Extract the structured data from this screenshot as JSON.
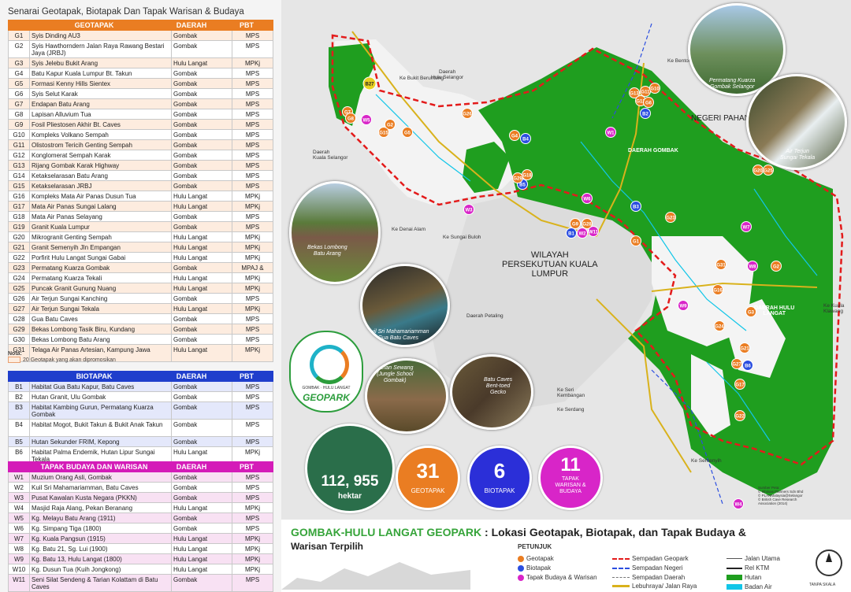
{
  "panel_title": "Senarai Geotapak, Biotapak Dan Tapak Warisan & Budaya",
  "geo_header": [
    "GEOTAPAK",
    "DAERAH",
    "PBT"
  ],
  "geo_rows": [
    [
      "G1",
      "Syis Dinding AU3",
      "Gombak",
      "MPS"
    ],
    [
      "G2",
      "Syis Hawthorndern Jalan Raya Rawang Bestari Jaya (JRBJ)",
      "Gombak",
      "MPS"
    ],
    [
      "G3",
      "Syis Jelebu Bukit Arang",
      "Hulu Langat",
      "MPKj"
    ],
    [
      "G4",
      "Batu Kapur Kuala Lumpur Bt. Takun",
      "Gombak",
      "MPS"
    ],
    [
      "G5",
      "Formasi Kenny Hills Sientex",
      "Gombak",
      "MPS"
    ],
    [
      "G6",
      "Syis Selut Karak",
      "Gombak",
      "MPS"
    ],
    [
      "G7",
      "Endapan Batu Arang",
      "Gombak",
      "MPS"
    ],
    [
      "G8",
      "Lapisan Alluvium Tua",
      "Gombak",
      "MPS"
    ],
    [
      "G9",
      "Fosil Pliestosen Akhir Bt. Caves",
      "Gombak",
      "MPS"
    ],
    [
      "G10",
      "Kompleks Volkano Sempah",
      "Gombak",
      "MPS"
    ],
    [
      "G11",
      "Olistostrom Tericih Genting Sempah",
      "Gombak",
      "MPS"
    ],
    [
      "G12",
      "Konglomerat Sempah Karak",
      "Gombak",
      "MPS"
    ],
    [
      "G13",
      "Rijang Gombak Karak Highway",
      "Gombak",
      "MPS"
    ],
    [
      "G14",
      "Ketakselarasan Batu Arang",
      "Gombak",
      "MPS"
    ],
    [
      "G15",
      "Ketakselarasan JRBJ",
      "Gombak",
      "MPS"
    ],
    [
      "G16",
      "Kompleks Mata Air Panas Dusun Tua",
      "Hulu Langat",
      "MPKj"
    ],
    [
      "G17",
      "Mata Air Panas Sungai Lalang",
      "Hulu Langat",
      "MPKj"
    ],
    [
      "G18",
      "Mata Air Panas Selayang",
      "Gombak",
      "MPS"
    ],
    [
      "G19",
      "Granit Kuala Lumpur",
      "Gombak",
      "MPS"
    ],
    [
      "G20",
      "Mikrogranit Genting Sempah",
      "Hulu Langat",
      "MPKj"
    ],
    [
      "G21",
      "Granit Semenyih Jln Empangan",
      "Hulu Langat",
      "MPKj"
    ],
    [
      "G22",
      "Porfirit Hulu Langat Sungai Gabai",
      "Hulu Langat",
      "MPKj"
    ],
    [
      "G23",
      "Permatang Kuarza Gombak",
      "Gombak",
      "MPAJ & MPS"
    ],
    [
      "G24",
      "Permatang Kuarza Tekali",
      "Hulu Langat",
      "MPKj"
    ],
    [
      "G25",
      "Puncak Granit Gunung Nuang",
      "Hulu Langat",
      "MPKj"
    ],
    [
      "G26",
      "Air Terjun Sungai Kanching",
      "Gombak",
      "MPS"
    ],
    [
      "G27",
      "Air Terjun Sungai Tekala",
      "Hulu Langat",
      "MPKj"
    ],
    [
      "G28",
      "Gua Batu Caves",
      "Gombak",
      "MPS"
    ],
    [
      "G29",
      "Bekas Lombong Tasik Biru, Kundang",
      "Gombak",
      "MPS"
    ],
    [
      "G30",
      "Bekas Lombong Batu Arang",
      "Gombak",
      "MPS"
    ],
    [
      "G31",
      "Telaga Air Panas Artesian, Kampung Jawa",
      "Hulu Langat",
      "MPKj"
    ]
  ],
  "note_title": "Nota:",
  "note_text": "20 Geotapak yang akan dipromosikan",
  "bio_header": [
    "BIOTAPAK",
    "DAERAH",
    "PBT"
  ],
  "bio_rows": [
    [
      "B1",
      "Habitat Gua Batu Kapur, Batu Caves",
      "Gombak",
      "MPS"
    ],
    [
      "B2",
      "Hutan Granit, Ulu Gombak",
      "Gombak",
      "MPS"
    ],
    [
      "B3",
      "Habitat Kambing Gurun, Permatang Kuarza Gombak",
      "Gombak",
      "MPS"
    ],
    [
      "B4",
      "Habitat Mogot, Bukit Takun & Bukit Anak Takun",
      "Gombak",
      "MPS"
    ],
    [
      "B5",
      "Hutan Sekunder FRIM, Kepong",
      "Gombak",
      "MPS"
    ],
    [
      "B6",
      "Habitat Palma Endemik, Hutan Lipur Sungai Tekala",
      "Hulu Langat",
      "MPKj"
    ]
  ],
  "wb_header": [
    "TAPAK BUDAYA DAN WARISAN",
    "DAERAH",
    "PBT"
  ],
  "wb_rows": [
    [
      "W1",
      "Muzium Orang Asli, Gombak",
      "Gombak",
      "MPS"
    ],
    [
      "W2",
      "Kuil Sri Mahamariamman, Batu Caves",
      "Gombak",
      "MPS"
    ],
    [
      "W3",
      "Pusat Kawalan Kusta Negara (PKKN)",
      "Gombak",
      "MPS"
    ],
    [
      "W4",
      "Masjid Raja Alang, Pekan Beranang",
      "Hulu Langat",
      "MPKj"
    ],
    [
      "W5",
      "Kg. Melayu Batu Arang (1911)",
      "Gombak",
      "MPS"
    ],
    [
      "W6",
      "Kg. Simpang Tiga (1800)",
      "Gombak",
      "MPS"
    ],
    [
      "W7",
      "Kg. Kuala Pangsun (1915)",
      "Hulu Langat",
      "MPKj"
    ],
    [
      "W8",
      "Kg. Batu 21, Sg. Lui (1900)",
      "Hulu Langat",
      "MPKj"
    ],
    [
      "W9",
      "Kg. Batu 13, Hulu Langat (1800)",
      "Hulu Langat",
      "MPKj"
    ],
    [
      "W10",
      "Kg. Dusun Tua (Kuih Jongkong)",
      "Hulu Langat",
      "MPKj"
    ],
    [
      "W11",
      "Seni Silat Sendeng & Tarian Kolattam di Batu Caves",
      "Gombak",
      "MPS"
    ]
  ],
  "map_labels": {
    "hulu_selangor": "Daerah\nHulu Selangor",
    "kuala_selangor": "Daerah\nKuala Selangor",
    "negeri_pahang": "NEGERI PAHANG",
    "daerah_gombak": "DAERAH GOMBAK",
    "wp_kl": "WILAYAH\nPERSEKUTUAN KUALA\nLUMPUR",
    "daerah_petaling": "Daerah Petaling",
    "daerah_hulu_langat": "DAERAH HULU\nLANGAT",
    "to_bukit_beruntung": "Ke Bukit Beruntung",
    "to_bentong": "Ke Bentong",
    "to_sungai_buloh": "Ke Sungai Buloh",
    "to_denai_alam": "Ke Denai Alam",
    "to_seri_kembangan": "Ke Seri\nKembangan",
    "to_serdang": "Ke Serdang",
    "to_semenyih": "Ke Semenyih",
    "to_kuala_klawang": "Ke Kuala\nKlawang"
  },
  "photo_captions": {
    "permatang": "Permatang Kuarza\nGombak Selangor",
    "air_terjun": "Air Terjun\nSungai Tekala",
    "lombong": "Bekas Lombong\nBatu Arang",
    "kuil": "Kuil Sri Mahamariamman\nGua Batu Caves",
    "tarian": "Tarian Sewang\n(Jungle School\nGombak)",
    "gecko": "Batu Caves\nBent-toed\nGecko"
  },
  "logo": {
    "top_text": "GOMBAK · HULU LANGAT",
    "name": "GEOPARK"
  },
  "stats": {
    "area_value": "112, 955",
    "area_unit": "hektar",
    "geo_count": "31",
    "geo_label": "GEOTAPAK",
    "bio_count": "6",
    "bio_label": "BIOTAPAK",
    "wb_count": "11",
    "wb_label": "TAPAK\nWARISAN &\nBUDAYA"
  },
  "footer": {
    "title_green": "GOMBAK-HULU LANGAT GEOPARK",
    "title_rest": " : Lokasi Geotapak, Biotapak, dan Tapak Budaya &",
    "subtitle": "Warisan Terpilih",
    "legend_title": "PETUNJUK",
    "legend": {
      "geo": "Geotapak",
      "bio": "Biotapak",
      "wb": "Tapak Budaya & Warisan",
      "sempadan_geopark": "Sempadan Geopark",
      "sempadan_negeri": "Sempadan Negeri",
      "sempadan_daerah": "Sempadan Daerah",
      "lebuhraya": "Lebuhraya/ Jalan Raya",
      "jalan_utama": "Jalan Utama",
      "rel_ktm": "Rel KTM",
      "hutan": "Hutan",
      "badan_air": "Badan Air"
    },
    "scale": "TANPA SKALA",
    "source": "Sumber Peta:\n© Ikhtisas Planners Sdn Bhd\n© PLANMalaysia@Selangor\n© British Cave Research\nAssociation (2014)"
  },
  "colors": {
    "forest": "#1f9e1f",
    "geo": "#ea7d22",
    "bio": "#2b4ee0",
    "wb": "#d825c8",
    "boundary": "#e31b1b",
    "water": "#12c6e8"
  },
  "markers": [
    {
      "id": "B27",
      "type": "road"
    },
    {
      "id": "G7",
      "type": "geo"
    },
    {
      "id": "G8",
      "type": "geo"
    },
    {
      "id": "W5",
      "type": "wb"
    },
    {
      "id": "G2",
      "type": "geo"
    },
    {
      "id": "G15",
      "type": "geo"
    },
    {
      "id": "G5",
      "type": "geo"
    },
    {
      "id": "G26",
      "type": "geo"
    },
    {
      "id": "G4",
      "type": "geo"
    },
    {
      "id": "B4",
      "type": "bio"
    },
    {
      "id": "G13",
      "type": "geo"
    },
    {
      "id": "G12",
      "type": "geo"
    },
    {
      "id": "G11",
      "type": "geo"
    },
    {
      "id": "G6",
      "type": "geo"
    },
    {
      "id": "G10",
      "type": "geo"
    },
    {
      "id": "B2",
      "type": "bio"
    },
    {
      "id": "W1",
      "type": "wb"
    },
    {
      "id": "G18",
      "type": "geo"
    },
    {
      "id": "B5",
      "type": "bio"
    },
    {
      "id": "G29",
      "type": "geo"
    },
    {
      "id": "W3",
      "type": "wb"
    },
    {
      "id": "W6",
      "type": "wb"
    },
    {
      "id": "B3",
      "type": "bio"
    },
    {
      "id": "G9",
      "type": "geo"
    },
    {
      "id": "G28",
      "type": "geo"
    },
    {
      "id": "B1",
      "type": "bio"
    },
    {
      "id": "W2",
      "type": "wb"
    },
    {
      "id": "W11",
      "type": "wb"
    },
    {
      "id": "G23",
      "type": "geo"
    },
    {
      "id": "G1",
      "type": "geo"
    },
    {
      "id": "G20",
      "type": "geo"
    },
    {
      "id": "G25",
      "type": "geo"
    },
    {
      "id": "W7",
      "type": "wb"
    },
    {
      "id": "G31",
      "type": "geo"
    },
    {
      "id": "W8",
      "type": "wb"
    },
    {
      "id": "G2",
      "type": "geo"
    },
    {
      "id": "G16",
      "type": "geo"
    },
    {
      "id": "W9",
      "type": "wb"
    },
    {
      "id": "G3",
      "type": "geo"
    },
    {
      "id": "G24",
      "type": "geo"
    },
    {
      "id": "G21",
      "type": "geo"
    },
    {
      "id": "G27",
      "type": "geo"
    },
    {
      "id": "B6",
      "type": "bio"
    },
    {
      "id": "G17",
      "type": "geo"
    },
    {
      "id": "G22",
      "type": "geo"
    },
    {
      "id": "W4",
      "type": "wb"
    }
  ]
}
